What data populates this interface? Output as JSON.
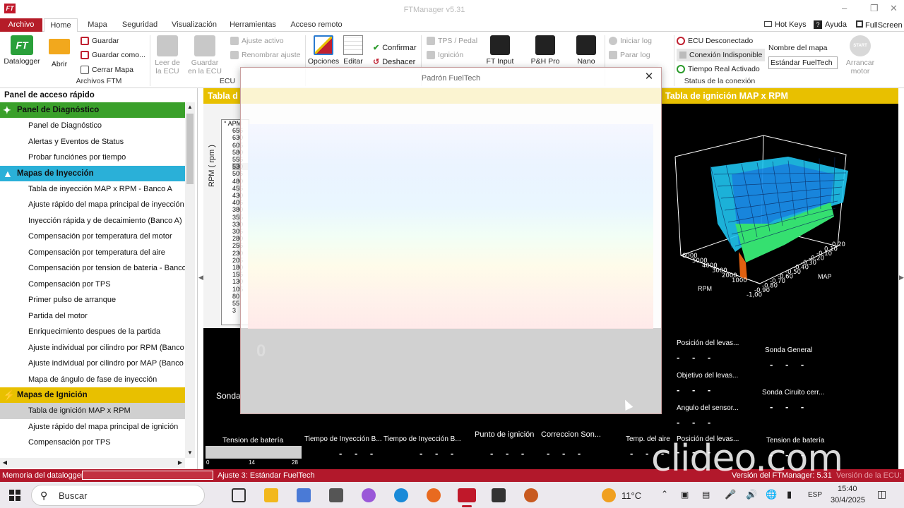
{
  "window": {
    "title": "FTManager v5.31"
  },
  "menu": {
    "tabs": [
      "Archivo",
      "Home",
      "Mapa",
      "Seguridad",
      "Visualización",
      "Herramientas",
      "Acceso remoto"
    ],
    "right": {
      "hotkeys": "Hot Keys",
      "ayuda": "Ayuda",
      "fullscreen": "FullScreen"
    }
  },
  "ribbon": {
    "datalogger": "Datalogger",
    "abrir": "Abrir",
    "guardar": "Guardar",
    "guardar_como": "Guardar como...",
    "cerrar_mapa": "Cerrar Mapa",
    "archivos_ftm": "Archivos FTM",
    "leer_ecu": "Leer de la ECU",
    "guardar_ecu": "Guardar en la ECU",
    "ajuste_activo": "Ajuste activo",
    "renombrar_ajuste": "Renombrar ajuste",
    "ecu_group": "ECU",
    "opciones": "Opciones",
    "editar": "Editar",
    "confirmar": "Confirmar",
    "deshacer": "Deshacer",
    "tps_pedal": "TPS / Pedal",
    "ignicion": "Ignición",
    "ft_input": "FT Input",
    "ph_pro": "P&H Pro",
    "nano": "Nano",
    "iniciar_log": "Iniciar log",
    "parar_log": "Parar log",
    "ecu_desconectado": "ECU Desconectado",
    "conexion_indisponible": "Conexión Indisponible",
    "tiempo_real": "Tiempo Real Activado",
    "status_conexion": "Status de la conexión",
    "nombre_mapa_label": "Nombre del mapa",
    "nombre_mapa_value": "Estándar FuelTech",
    "arrancar_motor": "Arrancar motor",
    "start_badge": "START"
  },
  "side": {
    "title": "Panel de acceso rápido",
    "sections": [
      {
        "label": "Panel de Diagnóstico",
        "color": "#3aa02a",
        "items": [
          "Panel de Diagnóstico",
          "Alertas y Eventos de Status",
          "Probar funciónes por tiempo"
        ]
      },
      {
        "label": "Mapas de Inyección",
        "color": "#2ab0d8",
        "items": [
          "Tabla de inyección MAP x RPM - Banco A",
          "Ajuste rápido del mapa principal de inyección",
          "Inyección rápida y de decaimiento (Banco A)",
          "Compensación por temperatura del motor",
          "Compensación por temperatura del aire",
          "Compensación por tension de bateria - Banco A",
          "Compensación por TPS",
          "Primer pulso de arranque",
          "Partida del motor",
          "Enriquecimiento despues de la partida",
          "Ajuste individual por cilindro por RPM (Banco A)",
          "Ajuste individual por cilindro por MAP (Banco A)",
          "Mapa de ángulo de fase de inyección"
        ]
      },
      {
        "label": "Mapas de Ignición",
        "color": "#e8c000",
        "items": [
          "Tabla de ignición MAP x RPM",
          "Ajuste rápido del mapa principal de ignición",
          "Compensación por TPS"
        ]
      }
    ]
  },
  "panes": {
    "left_title": "Tabla d",
    "right_title": "Tabla de ignición MAP x RPM",
    "rpm_header": "° APM",
    "rpm_axis": "RPM ( rpm )",
    "rpm_values": [
      "655",
      "630",
      "605",
      "580",
      "555",
      "530",
      "505",
      "480",
      "455",
      "430",
      "405",
      "380",
      "355",
      "330",
      "305",
      "280",
      "255",
      "230",
      "205",
      "180",
      "155",
      "130",
      "105",
      "80",
      "55",
      "3"
    ]
  },
  "chart3d": {
    "rpm_ticks": [
      "6000",
      "5000",
      "4000",
      "3000",
      "2000",
      "1000"
    ],
    "map_ticks": [
      "0.20",
      "0.10",
      "-0.10",
      "-0.20",
      "-0.30",
      "-0.40",
      "-0.50",
      "-0.60",
      "-0.70",
      "-0.80",
      "-0.90",
      "-1,00"
    ],
    "rpm_label": "RPM",
    "map_label": "MAP"
  },
  "dashboard": {
    "gauges": [
      {
        "label": "Posición del levas...",
        "value": "- - -"
      },
      {
        "label": "Sonda General",
        "value": "- - -"
      },
      {
        "label": "Objetivo del levas...",
        "value": "- - -"
      },
      {
        "label": "Sonda Ciruito cerr...",
        "value": "- - -"
      },
      {
        "label": "Angulo del sensor...",
        "value": "- - -"
      },
      {
        "label": "Posición del levas...",
        "value": "- - -"
      },
      {
        "label": "Tension de batería",
        "value": "- - -"
      },
      {
        "label": "Temp. del aire",
        "value": "- - -"
      },
      {
        "label": "Tiempo de Inyección B...",
        "value": "- - -"
      },
      {
        "label": "Tiempo de Inyección B...",
        "value": "- - -"
      },
      {
        "label": "Punto de ignición",
        "value": "- - -"
      },
      {
        "label": "Correccion Son...",
        "value": "- - -"
      },
      {
        "label": "Tension de batería",
        "value": ""
      }
    ],
    "bat_scale": [
      "0",
      "14",
      "28"
    ],
    "sonda_label": "Sonda"
  },
  "status": {
    "memoria": "Memoria del datalogger:",
    "ajuste": "Ajuste 3: Estándar FuelTech",
    "version": "Versión del FTManager: 5.31",
    "version_ecu": "Versión de la ECU:"
  },
  "modal": {
    "title": "Padrón FuelTech",
    "big_value": "0"
  },
  "taskbar": {
    "search": "Buscar",
    "temp": "11°C",
    "lang": "ESP",
    "time": "15:40",
    "date": "30/4/2025"
  },
  "watermark": "clideo.com"
}
